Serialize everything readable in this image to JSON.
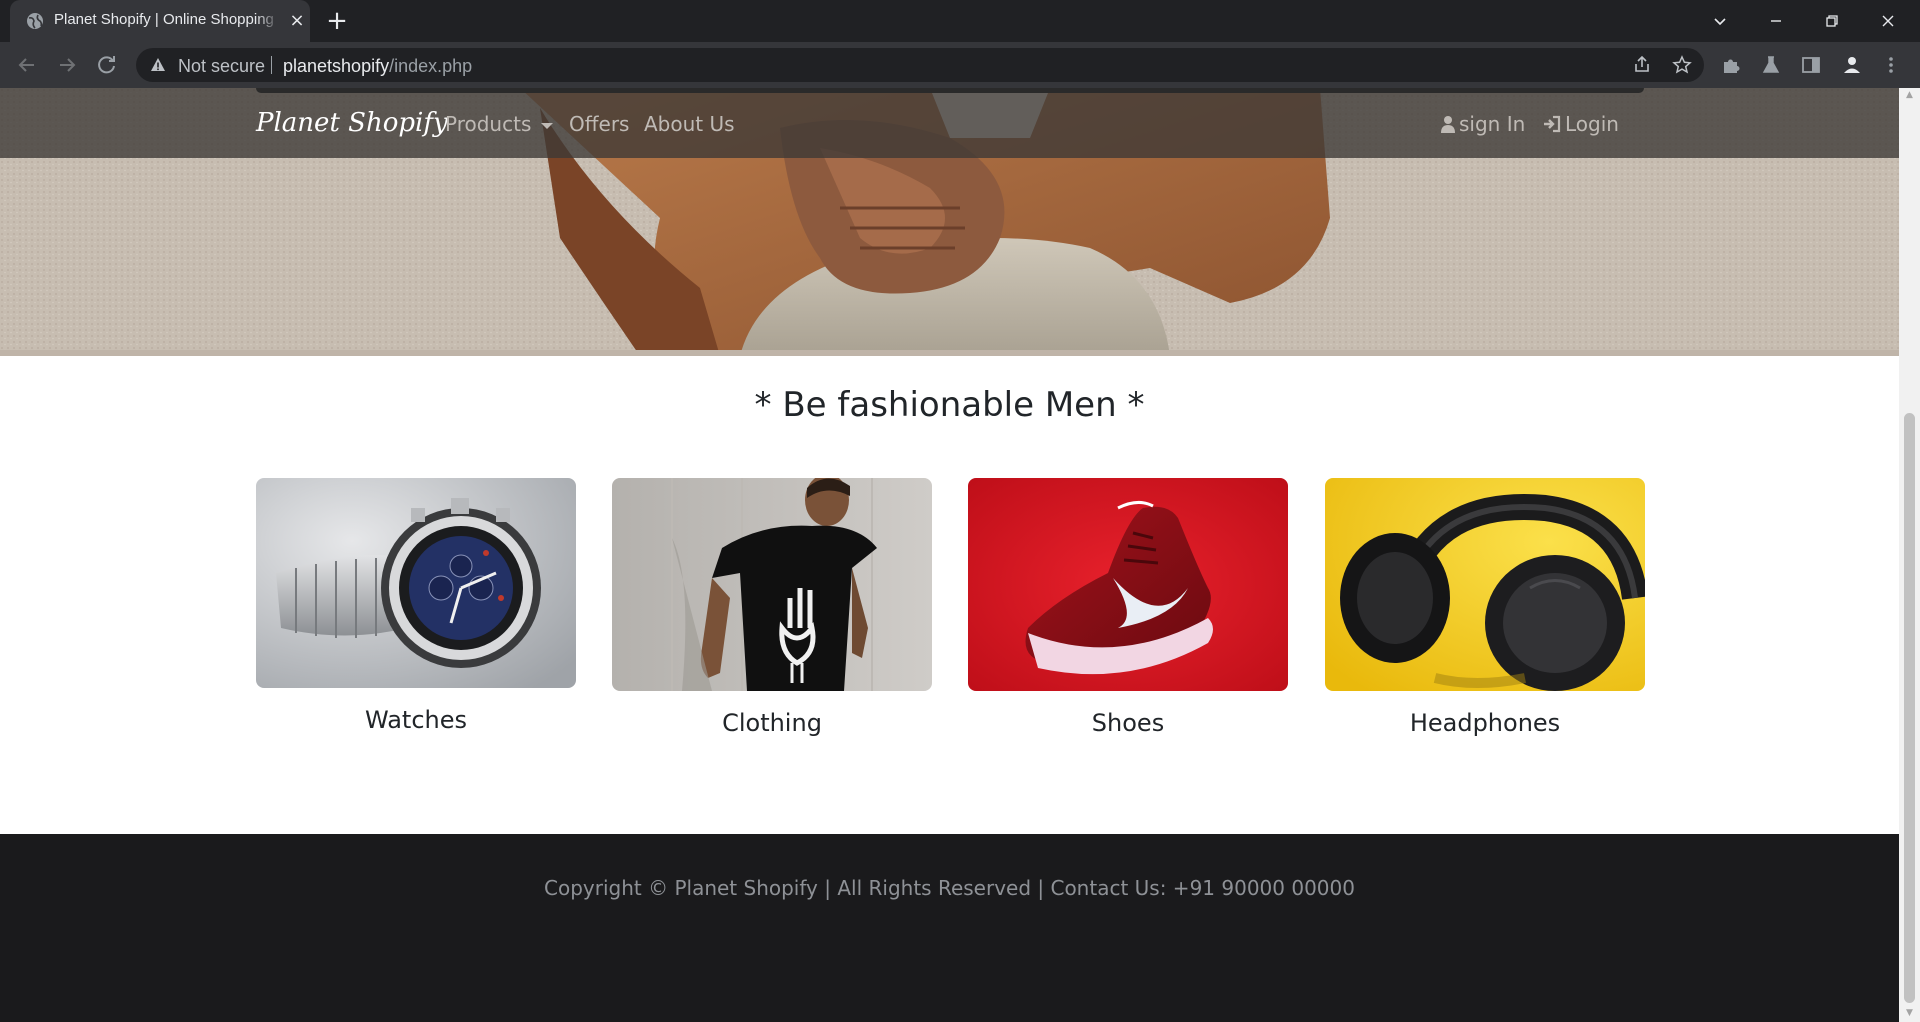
{
  "browser": {
    "tab_title": "Planet Shopify | Online Shopping",
    "tab_close_glyph": "×",
    "new_tab_glyph": "+",
    "security_label": "Not secure",
    "url_host": "planetshopify",
    "url_path": "/index.php"
  },
  "navbar": {
    "brand": "Planet Shopify",
    "links": [
      "Products",
      "Offers",
      "About Us"
    ],
    "signin_label": "sign In",
    "login_label": "Login"
  },
  "section": {
    "title": "* Be fashionable Men *"
  },
  "categories": [
    {
      "label": "Watches",
      "image": "watch-image"
    },
    {
      "label": "Clothing",
      "image": "clothing-image"
    },
    {
      "label": "Shoes",
      "image": "shoes-image"
    },
    {
      "label": "Headphones",
      "image": "headphones-image"
    }
  ],
  "footer": {
    "text": "Copyright © Planet Shopify | All Rights Reserved | Contact Us: +91 90000 00000"
  },
  "colors": {
    "footer_bg": "#1a1a1c",
    "navbar_overlay": "#3c3936",
    "shoes_bg": "#d4101c",
    "headphones_bg": "#f2cc1a"
  }
}
